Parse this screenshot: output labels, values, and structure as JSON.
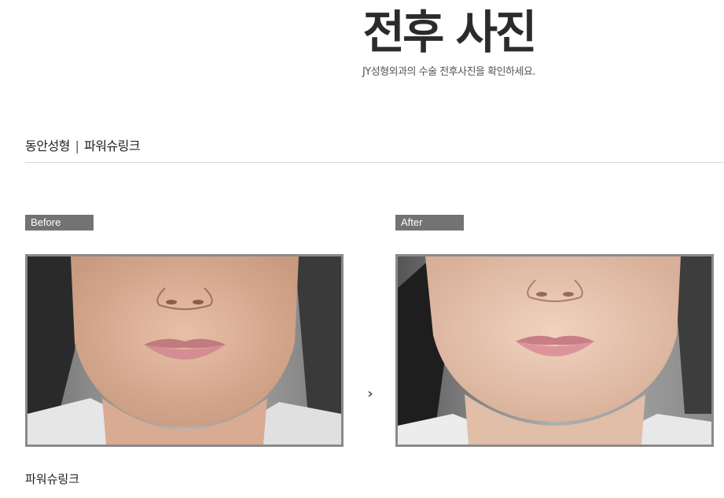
{
  "header": {
    "title": "전후 사진",
    "subtitle": "JY성형외과의 수술 전후사진을 확인하세요."
  },
  "category": {
    "main": "동안성형",
    "separator": "|",
    "sub": "파워슈링크"
  },
  "comparison": {
    "before_label": "Before",
    "after_label": "After",
    "arrow_icon": "chevron-right-icon"
  },
  "caption": "파워슈링크"
}
